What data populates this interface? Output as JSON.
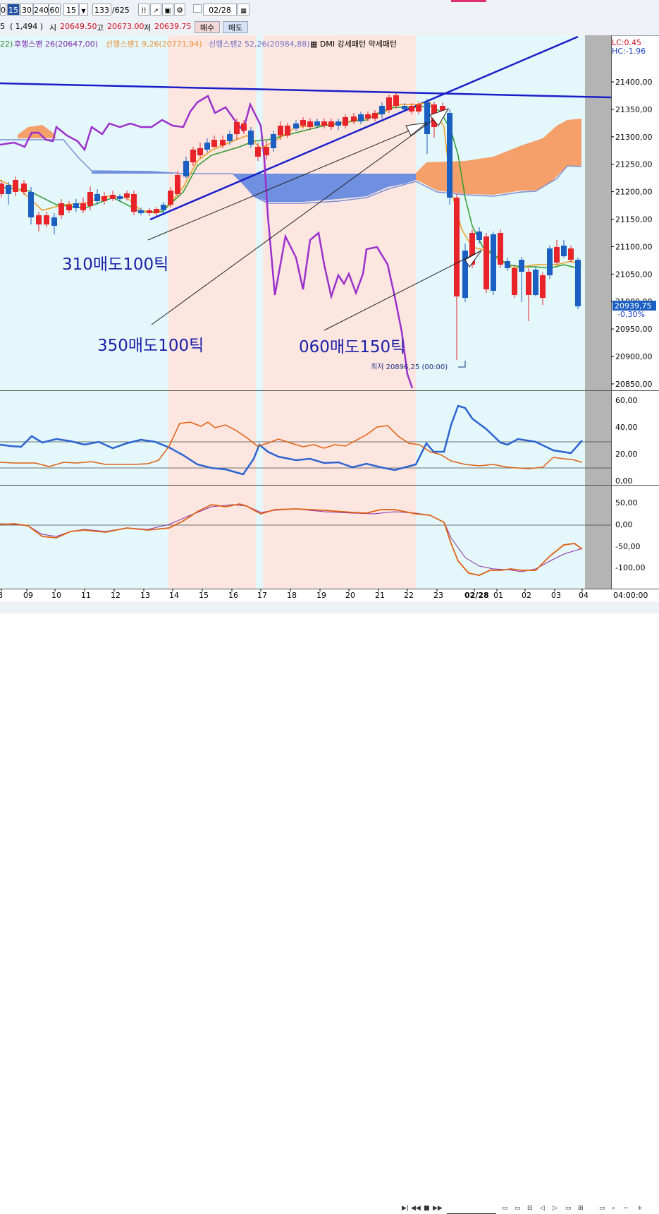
{
  "toolbar": {
    "periods": [
      "0",
      "15",
      "30",
      "240",
      "60"
    ],
    "selected_period": "15",
    "interval_value": "15",
    "count": "133",
    "total": "/625",
    "date_value": "02/28"
  },
  "quote": {
    "prefix": "5",
    "volume": "( 1,494 )",
    "open_label": "시",
    "open": "20649.50",
    "high_label": "고",
    "high": "20673.00",
    "low_label": "저",
    "low": "20639.75",
    "buy_label": "매수",
    "sell_label": "매도"
  },
  "legend": {
    "item0": "22)",
    "item1": "후행스팬 26(20647,00)",
    "item2": "선행스팬1 9,26(20771,94)",
    "item3": "선행스팬2 52,26(20984,88)",
    "item4": "DMI 강세패턴  약세패턴"
  },
  "corner": {
    "lc": "LC:0.45",
    "hc": "HC:-1.96"
  },
  "price_axis": [
    "21400,00",
    "21350,00",
    "21300,00",
    "21250,00",
    "21200,00",
    "21150,00",
    "21100,00",
    "21050,00",
    "21000,00",
    "20950,00",
    "20900,00",
    "20850,00"
  ],
  "current_price": {
    "value": "20939,75",
    "change": "-0,30%"
  },
  "low_label": "최저 20896,25 (00:00)",
  "annotations": {
    "a310": "310매도100틱",
    "a350": "350매도100틱",
    "a060": "060매도150틱"
  },
  "dmi_axis": [
    "60,00",
    "40,00",
    "20,00",
    "0,00"
  ],
  "macd_axis": [
    "50,00",
    "0,00",
    "-50,00",
    "-100,00"
  ],
  "time_axis": {
    "labels": [
      "8",
      "09",
      "10",
      "11",
      "12",
      "13",
      "14",
      "15",
      "16",
      "17",
      "18",
      "19",
      "20",
      "21",
      "22",
      "23",
      "02/28",
      "01",
      "02",
      "03",
      "04"
    ],
    "right_label": "04:00:00"
  },
  "colors": {
    "up_candle": "#e8232a",
    "down_candle": "#1b5fc2",
    "trendline": "#1a1ec8",
    "lagging_span": "#9b30cc",
    "cloud_bull": "#f5a06a",
    "cloud_bear": "#6f8fe0",
    "pink_zone": "#fde6e0",
    "plot_bg": "#e4f7fb"
  }
}
